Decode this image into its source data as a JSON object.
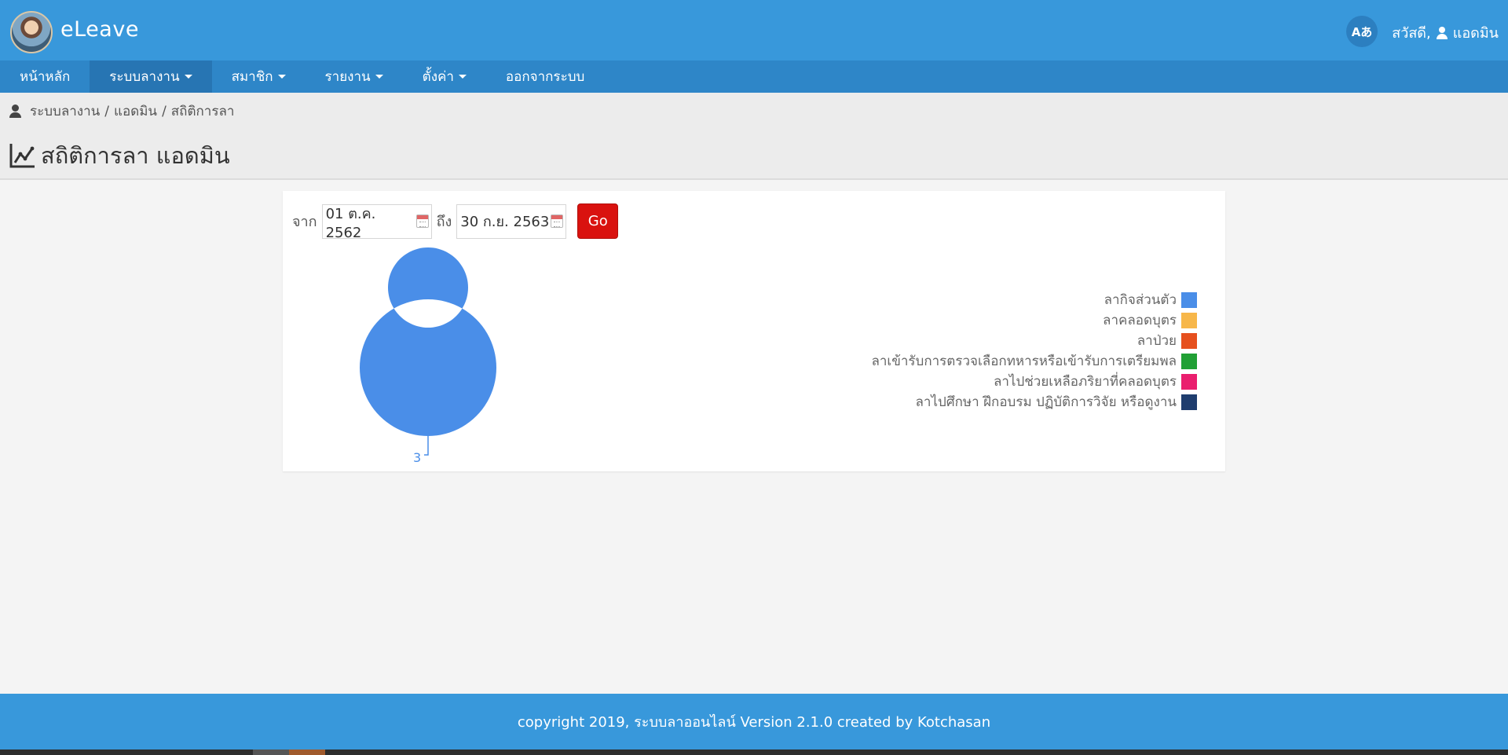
{
  "header": {
    "app_name": "eLeave",
    "lang_label": "Aあ",
    "greeting": "สวัสดี,",
    "user_name": "แอดมิน"
  },
  "nav": {
    "items": [
      {
        "label": "หน้าหลัก",
        "dropdown": false,
        "active": false
      },
      {
        "label": "ระบบลางาน",
        "dropdown": true,
        "active": true
      },
      {
        "label": "สมาชิก",
        "dropdown": true,
        "active": false
      },
      {
        "label": "รายงาน",
        "dropdown": true,
        "active": false
      },
      {
        "label": "ตั้งค่า",
        "dropdown": true,
        "active": false
      },
      {
        "label": "ออกจากระบบ",
        "dropdown": false,
        "active": false
      }
    ]
  },
  "breadcrumb": {
    "items": [
      "ระบบลางาน",
      "แอดมิน",
      "สถิติการลา"
    ],
    "separator": "/"
  },
  "page": {
    "title": "สถิติการลา แอดมิน"
  },
  "filter": {
    "from_label": "จาก",
    "from_value": "01 ต.ค. 2562",
    "to_label": "ถึง",
    "to_value": "30 ก.ย. 2563",
    "go_label": "Go"
  },
  "colors": {
    "primary": "#3898db",
    "nav": "#2e86c8",
    "go_button": "#d9120f"
  },
  "chart_data": {
    "type": "pie",
    "variant": "donut",
    "title": "",
    "categories": [
      "ลากิจส่วนตัว",
      "ลาคลอดบุตร",
      "ลาป่วย",
      "ลาเข้ารับการตรวจเลือกทหารหรือเข้ารับการเตรียมพล",
      "ลาไปช่วยเหลือภริยาที่คลอดบุตร",
      "ลาไปศึกษา ฝึกอบรม ปฏิบัติการวิจัย หรือดูงาน"
    ],
    "values": [
      3,
      0,
      0,
      0,
      0,
      0
    ],
    "colors": [
      "#4a8ee8",
      "#f7b74a",
      "#e6501e",
      "#21a035",
      "#ea1e6e",
      "#1f3d6e"
    ],
    "data_labels": [
      "3"
    ],
    "legend_position": "right"
  },
  "footer": {
    "text": "copyright 2019, ระบบลาออนไลน์ Version 2.1.0 created by Kotchasan"
  }
}
